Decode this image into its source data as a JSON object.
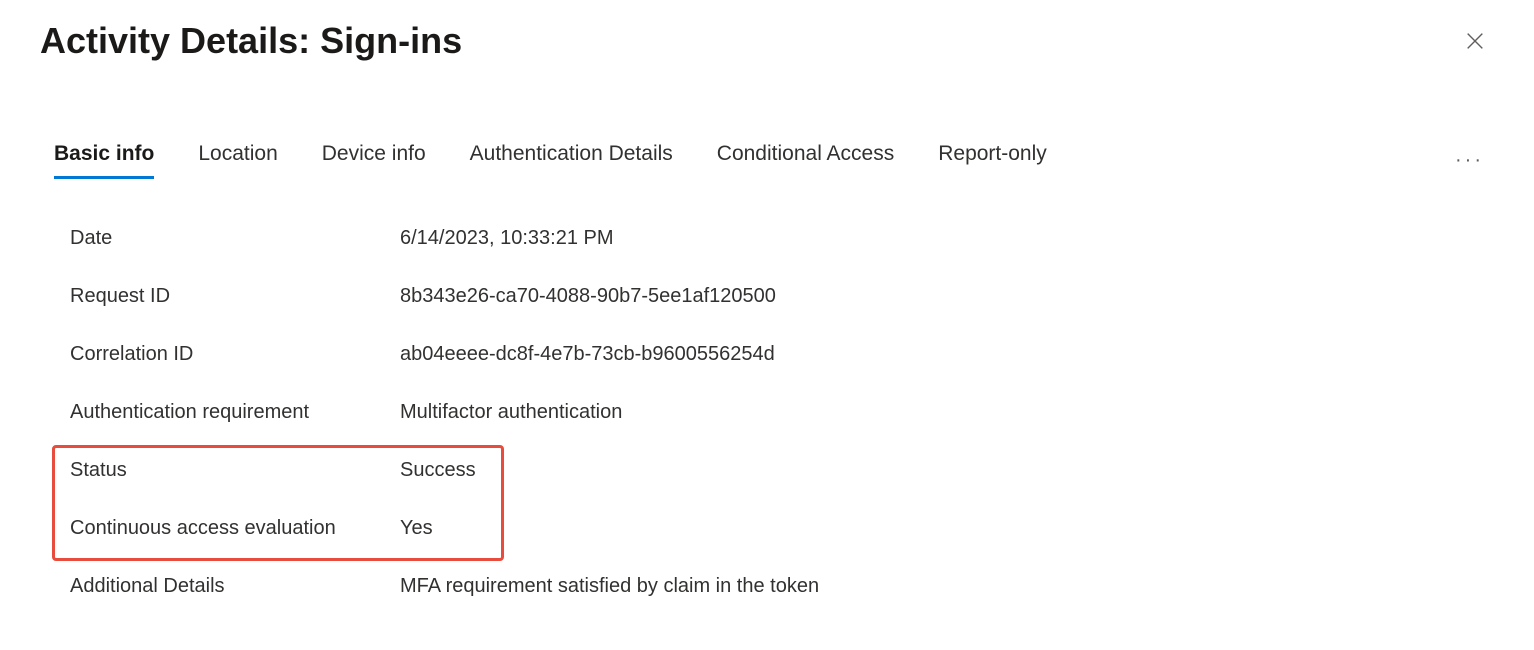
{
  "header": {
    "title": "Activity Details: Sign-ins"
  },
  "tabs": [
    {
      "label": "Basic info",
      "active": true
    },
    {
      "label": "Location",
      "active": false
    },
    {
      "label": "Device info",
      "active": false
    },
    {
      "label": "Authentication Details",
      "active": false
    },
    {
      "label": "Conditional Access",
      "active": false
    },
    {
      "label": "Report-only",
      "active": false
    }
  ],
  "fields": {
    "date": {
      "label": "Date",
      "value": "6/14/2023, 10:33:21 PM"
    },
    "request_id": {
      "label": "Request ID",
      "value": "8b343e26-ca70-4088-90b7-5ee1af120500"
    },
    "correlation_id": {
      "label": "Correlation ID",
      "value": "ab04eeee-dc8f-4e7b-73cb-b9600556254d"
    },
    "auth_req": {
      "label": "Authentication requirement",
      "value": "Multifactor authentication"
    },
    "status": {
      "label": "Status",
      "value": "Success"
    },
    "cae": {
      "label": "Continuous access evaluation",
      "value": "Yes"
    },
    "additional": {
      "label": "Additional Details",
      "value": "MFA requirement satisfied by claim in the token"
    }
  }
}
